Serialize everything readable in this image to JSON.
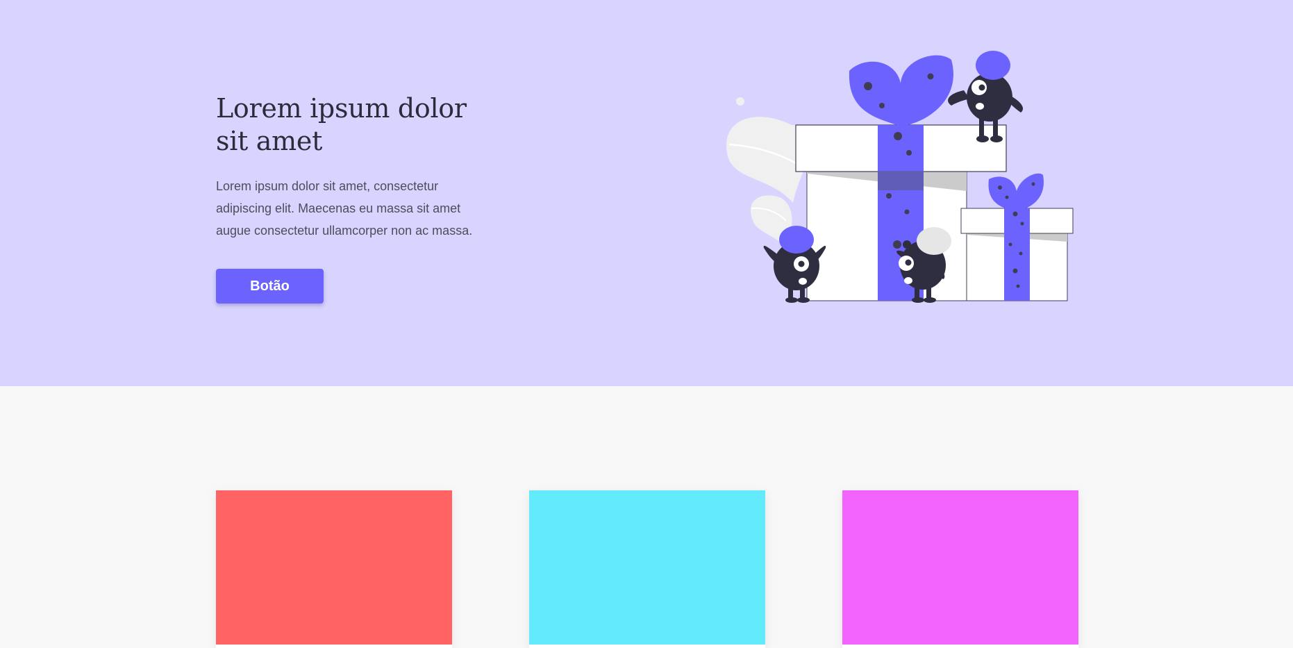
{
  "hero": {
    "title": "Lorem ipsum dolor sit amet",
    "description": "Lorem ipsum dolor sit amet, consectetur adipiscing elit. Maecenas eu massa sit amet augue consectetur ullamcorper non ac massa.",
    "button_label": "Botão",
    "illustration": "gift-boxes-with-monsters-illustration"
  },
  "colors": {
    "hero_background": "#d8d4ff",
    "content_background": "#f8f8f8",
    "accent": "#6c63ff",
    "monster_body": "#2f2e41",
    "card_1": "#ff6363",
    "card_2": "#63eafd",
    "card_3": "#f263fd"
  },
  "cards": [
    {
      "image": "red-placeholder-image",
      "color": "#ff6363"
    },
    {
      "image": "cyan-placeholder-image",
      "color": "#63eafd"
    },
    {
      "image": "magenta-placeholder-image",
      "color": "#f263fd"
    }
  ]
}
